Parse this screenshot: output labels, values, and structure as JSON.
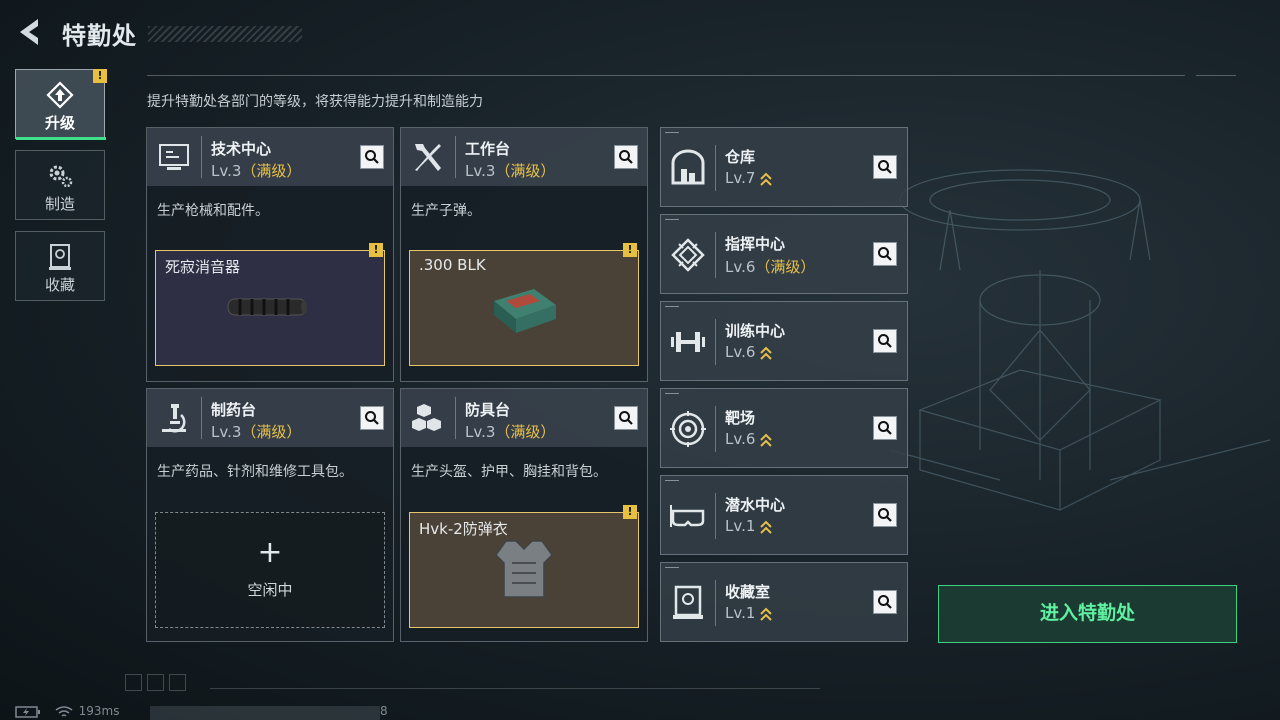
{
  "header": {
    "title": "特勤处"
  },
  "subtitle": "提升特勤处各部门的等级，将获得能力提升和制造能力",
  "nav": [
    {
      "label": "升级",
      "icon": "upgrade-icon",
      "active": true
    },
    {
      "label": "制造",
      "icon": "gear-icon",
      "active": false
    },
    {
      "label": "收藏",
      "icon": "collection-icon",
      "active": false
    }
  ],
  "big_cards": [
    {
      "name": "技术中心",
      "level": "Lv.3",
      "max_text": "（满级）",
      "desc": "生产枪械和配件。",
      "icon": "monitor-icon",
      "slot": {
        "type": "item",
        "name": "死寂消音器",
        "bg": "#2e2f44",
        "icon": "suppressor-icon"
      }
    },
    {
      "name": "工作台",
      "level": "Lv.3",
      "max_text": "（满级）",
      "desc": "生产子弹。",
      "icon": "tools-icon",
      "slot": {
        "type": "item",
        "name": ".300 BLK",
        "bg": "#4a4236",
        "icon": "ammo-box-icon"
      }
    },
    {
      "name": "制药台",
      "level": "Lv.3",
      "max_text": "（满级）",
      "desc": "生产药品、针剂和维修工具包。",
      "icon": "microscope-icon",
      "slot": {
        "type": "empty",
        "plus": "+",
        "label": "空闲中"
      }
    },
    {
      "name": "防具台",
      "level": "Lv.3",
      "max_text": "（满级）",
      "desc": "生产头盔、护甲、胸挂和背包。",
      "icon": "cubes-icon",
      "slot": {
        "type": "item",
        "name": "Hvk-2防弹衣",
        "bg": "#4a4236",
        "icon": "armor-vest-icon"
      }
    }
  ],
  "small_cards": [
    {
      "name": "仓库",
      "level": "Lv.7",
      "max_text": "",
      "upgradable": true,
      "icon": "warehouse-icon"
    },
    {
      "name": "指挥中心",
      "level": "Lv.6",
      "max_text": "（满级）",
      "upgradable": false,
      "icon": "chip-icon"
    },
    {
      "name": "训练中心",
      "level": "Lv.6",
      "max_text": "",
      "upgradable": true,
      "icon": "dumbbell-icon"
    },
    {
      "name": "靶场",
      "level": "Lv.6",
      "max_text": "",
      "upgradable": true,
      "icon": "target-icon"
    },
    {
      "name": "潜水中心",
      "level": "Lv.1",
      "max_text": "",
      "upgradable": true,
      "icon": "diving-mask-icon"
    },
    {
      "name": "收藏室",
      "level": "Lv.1",
      "max_text": "",
      "upgradable": true,
      "icon": "collection-room-icon"
    }
  ],
  "badge": "!",
  "enter_button": "进入特勤处",
  "status": {
    "ping": "193ms",
    "counter": "8"
  },
  "colors": {
    "accent_green": "#3fd183",
    "max_level_gold": "#e8c04a",
    "slot_border": "#e5c76a"
  }
}
